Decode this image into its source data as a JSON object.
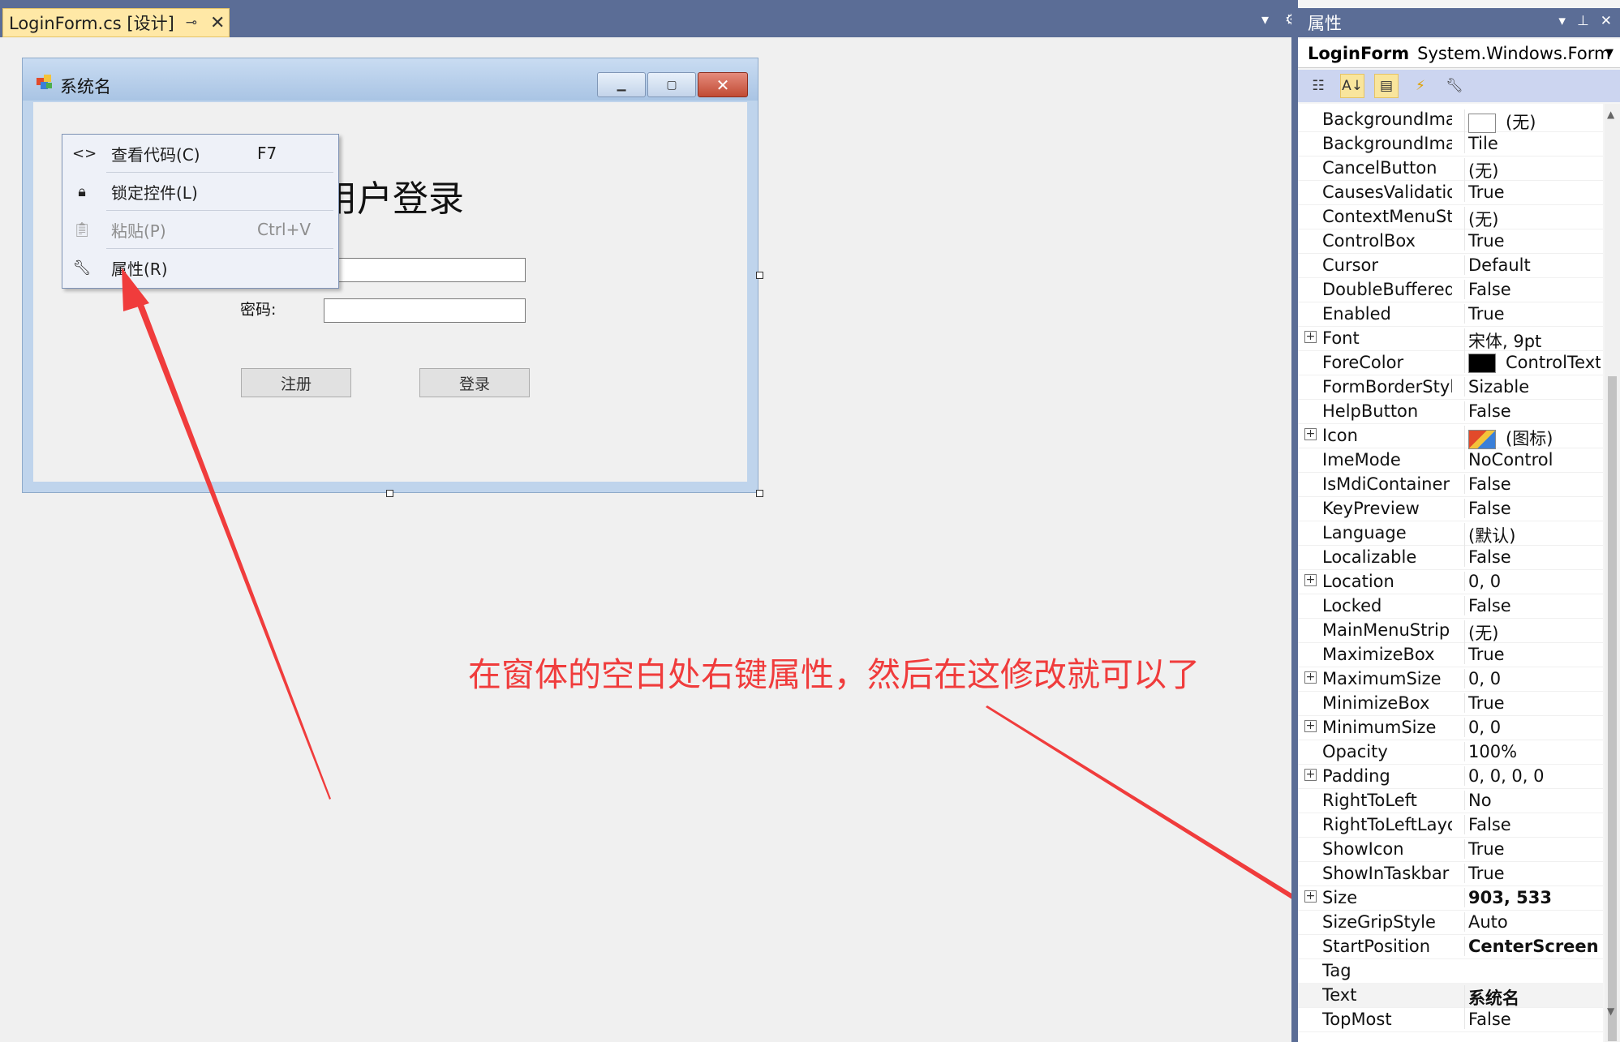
{
  "document_tab": {
    "title": "LoginForm.cs [设计]"
  },
  "designed_form": {
    "title": "系统名",
    "login_title": "用户登录",
    "password_label": "密码:",
    "register_button": "注册",
    "login_button": "登录"
  },
  "context_menu": {
    "items": [
      {
        "label": "查看代码(C)",
        "shortcut": "F7",
        "icon": "code-icon",
        "enabled": true
      },
      {
        "label": "锁定控件(L)",
        "shortcut": "",
        "icon": "lock-icon",
        "enabled": true
      },
      {
        "label": "粘贴(P)",
        "shortcut": "Ctrl+V",
        "icon": "paste-icon",
        "enabled": false
      },
      {
        "label": "属性(R)",
        "shortcut": "",
        "icon": "wrench-icon",
        "enabled": true
      }
    ]
  },
  "annotation": "在窗体的空白处右键属性，然后在这修改就可以了",
  "properties_panel": {
    "title": "属性",
    "object_name": "LoginForm",
    "object_type": "System.Windows.Form",
    "toolbar_icons": [
      "categorized-icon",
      "alphabetical-icon",
      "properties-icon",
      "events-icon",
      "property-pages-icon"
    ],
    "rows": [
      {
        "name": "BackgroundImage",
        "value": "(无)"
      },
      {
        "name": "BackgroundImageLayout",
        "value": "Tile"
      },
      {
        "name": "CancelButton",
        "value": "(无)"
      },
      {
        "name": "CausesValidation",
        "value": "True"
      },
      {
        "name": "ContextMenuStrip",
        "value": "(无)"
      },
      {
        "name": "ControlBox",
        "value": "True"
      },
      {
        "name": "Cursor",
        "value": "Default"
      },
      {
        "name": "DoubleBuffered",
        "value": "False"
      },
      {
        "name": "Enabled",
        "value": "True"
      },
      {
        "name": "Font",
        "value": "宋体, 9pt"
      },
      {
        "name": "ForeColor",
        "value": "ControlText"
      },
      {
        "name": "FormBorderStyle",
        "value": "Sizable"
      },
      {
        "name": "HelpButton",
        "value": "False"
      },
      {
        "name": "Icon",
        "value": "(图标)"
      },
      {
        "name": "ImeMode",
        "value": "NoControl"
      },
      {
        "name": "IsMdiContainer",
        "value": "False"
      },
      {
        "name": "KeyPreview",
        "value": "False"
      },
      {
        "name": "Language",
        "value": "(默认)"
      },
      {
        "name": "Localizable",
        "value": "False"
      },
      {
        "name": "Location",
        "value": "0, 0"
      },
      {
        "name": "Locked",
        "value": "False"
      },
      {
        "name": "MainMenuStrip",
        "value": "(无)"
      },
      {
        "name": "MaximizeBox",
        "value": "True"
      },
      {
        "name": "MaximumSize",
        "value": "0, 0"
      },
      {
        "name": "MinimizeBox",
        "value": "True"
      },
      {
        "name": "MinimumSize",
        "value": "0, 0"
      },
      {
        "name": "Opacity",
        "value": "100%"
      },
      {
        "name": "Padding",
        "value": "0, 0, 0, 0"
      },
      {
        "name": "RightToLeft",
        "value": "No"
      },
      {
        "name": "RightToLeftLayout",
        "value": "False"
      },
      {
        "name": "ShowIcon",
        "value": "True"
      },
      {
        "name": "ShowInTaskbar",
        "value": "True"
      },
      {
        "name": "Size",
        "value": "903, 533"
      },
      {
        "name": "SizeGripStyle",
        "value": "Auto"
      },
      {
        "name": "StartPosition",
        "value": "CenterScreen"
      },
      {
        "name": "Tag",
        "value": ""
      },
      {
        "name": "Text",
        "value": "系统名"
      },
      {
        "name": "TopMost",
        "value": "False"
      }
    ]
  },
  "colors": {
    "annotation": "#f03c3c",
    "tab_active": "#ffe8a6",
    "chrome": "#5b6d96"
  }
}
